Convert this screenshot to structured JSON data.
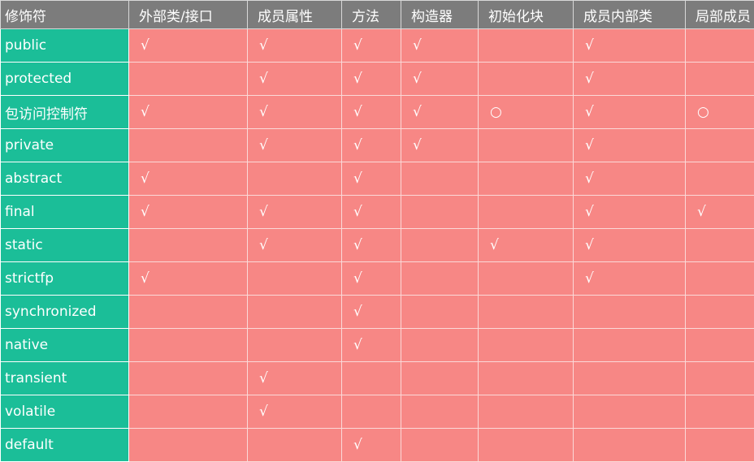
{
  "table": {
    "headers": [
      "修饰符",
      "外部类/接口",
      "成员属性",
      "方法",
      "构造器",
      "初始化块",
      "成员内部类",
      "局部成员"
    ],
    "rows": [
      [
        "public",
        "√",
        "√",
        "√",
        "√",
        "",
        "√",
        ""
      ],
      [
        "protected",
        "",
        "√",
        "√",
        "√",
        "",
        "√",
        ""
      ],
      [
        "包访问控制符",
        "√",
        "√",
        "√",
        "√",
        "○",
        "√",
        "○"
      ],
      [
        "private",
        "",
        "√",
        "√",
        "√",
        "",
        "√",
        ""
      ],
      [
        "abstract",
        "√",
        "",
        "√",
        "",
        "",
        "√",
        ""
      ],
      [
        "final",
        "√",
        "√",
        "√",
        "",
        "",
        "√",
        "√"
      ],
      [
        "static",
        "",
        "√",
        "√",
        "",
        "√",
        "√",
        ""
      ],
      [
        "strictfp",
        "√",
        "",
        "√",
        "",
        "",
        "√",
        ""
      ],
      [
        "synchronized",
        "",
        "",
        "√",
        "",
        "",
        "",
        ""
      ],
      [
        "native",
        "",
        "",
        "√",
        "",
        "",
        "",
        ""
      ],
      [
        "transient",
        "",
        "√",
        "",
        "",
        "",
        "",
        ""
      ],
      [
        "volatile",
        "",
        "√",
        "",
        "",
        "",
        "",
        ""
      ],
      [
        "default",
        "",
        "",
        "√",
        "",
        "",
        "",
        ""
      ]
    ]
  },
  "colors": {
    "header_bg": "#7c7c7c",
    "first_column_bg": "#1bbe98",
    "cell_bg": "#f78785",
    "text": "#ffffff"
  }
}
